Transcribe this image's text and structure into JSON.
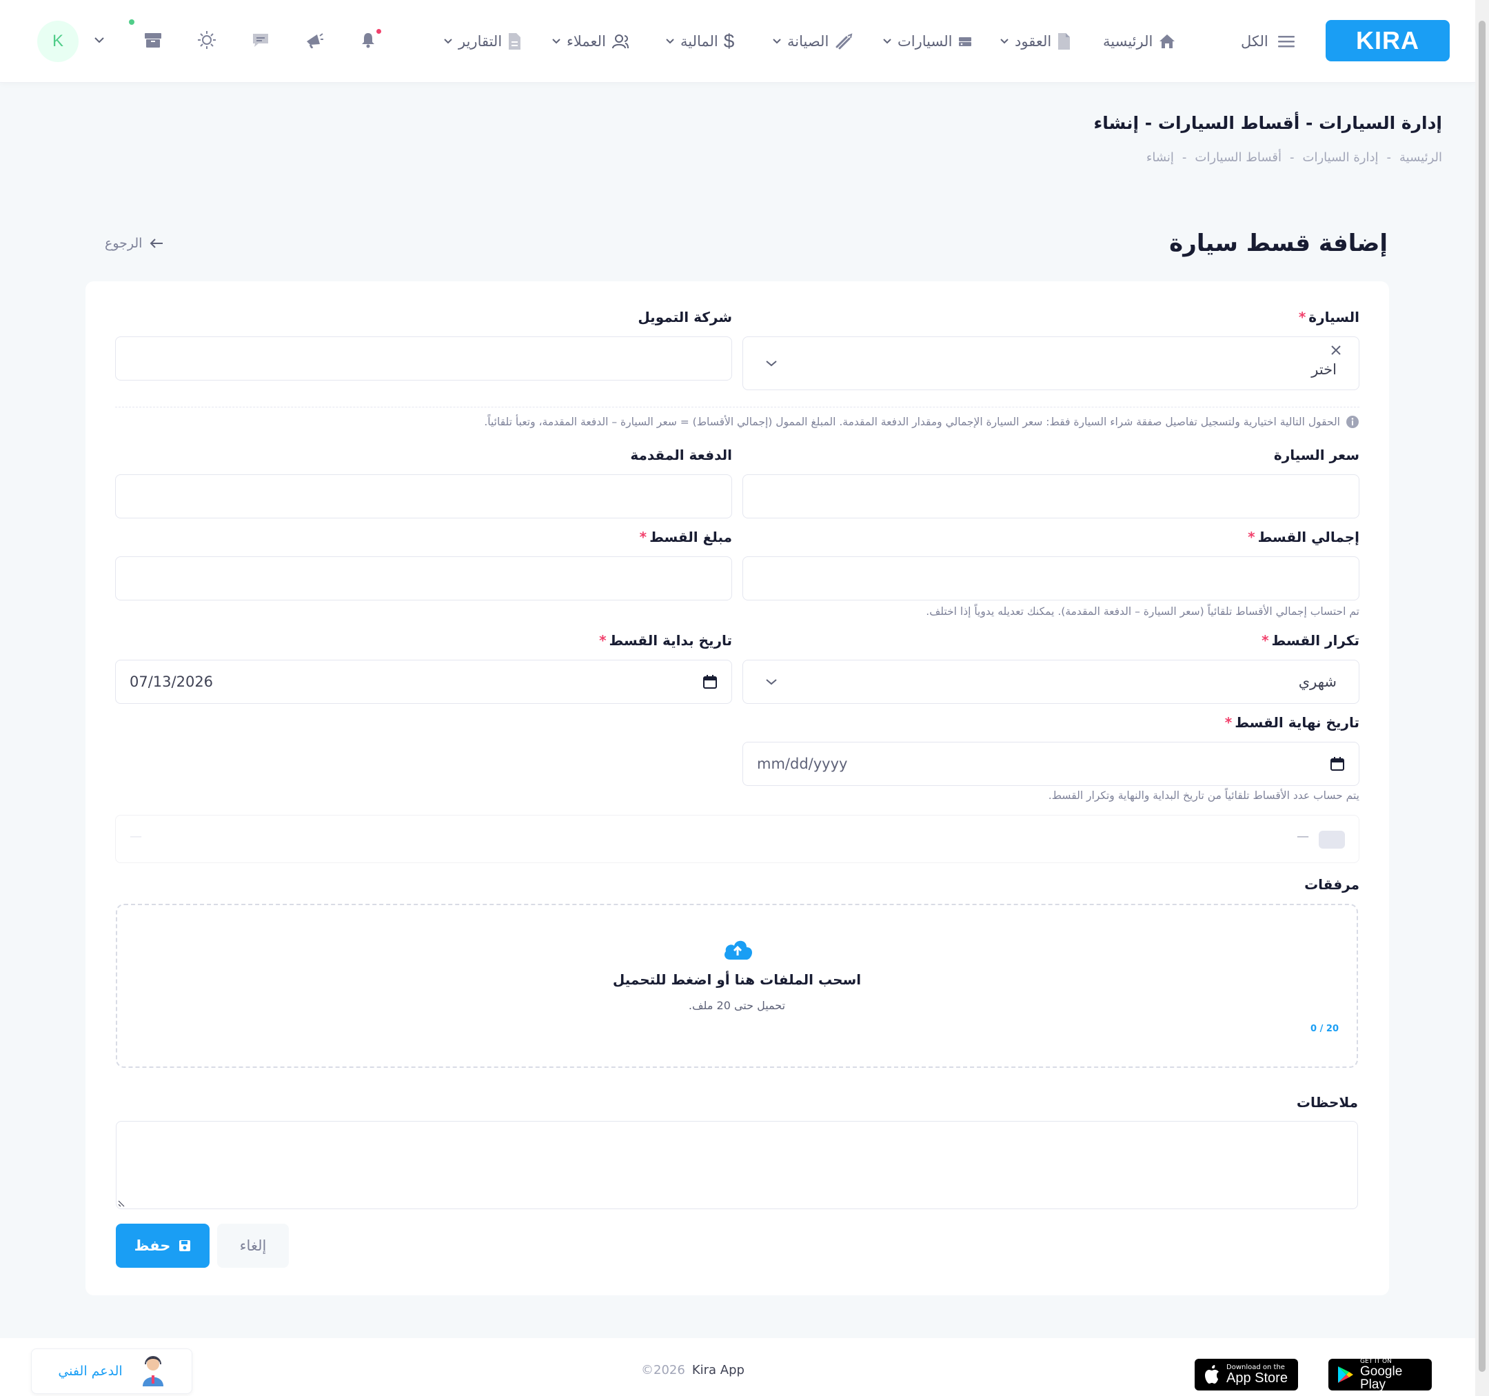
{
  "header": {
    "logo_text": "KIRA",
    "menu_all": "الكل",
    "nav": [
      {
        "label": "الرئيسية"
      },
      {
        "label": "العقود"
      },
      {
        "label": "السيارات"
      },
      {
        "label": "الصيانة"
      },
      {
        "label": "المالية"
      },
      {
        "label": "العملاء"
      },
      {
        "label": "التقارير"
      }
    ],
    "avatar_initial": "K"
  },
  "page": {
    "title": "إدارة السيارات - أقساط السيارات - إنشاء",
    "breadcrumb": [
      "الرئيسية",
      "إدارة السيارات",
      "أقساط السيارات",
      "إنشاء"
    ],
    "breadcrumb_sep": "-",
    "form_heading": "إضافة قسط سيارة",
    "back_label": "الرجوع"
  },
  "form": {
    "required_mark": "*",
    "car": {
      "label": "السيارة",
      "value": "اختر"
    },
    "finance_company": {
      "label": "شركة التمويل",
      "value": ""
    },
    "optional_note": "الحقول التالية اختيارية ولتسجيل تفاصيل صفقة شراء السيارة فقط: سعر السيارة الإجمالي ومقدار الدفعة المقدمة. المبلغ الممول (إجمالي الأقساط) = سعر السيارة – الدفعة المقدمة، وتعبأ تلقائياً.",
    "car_price": {
      "label": "سعر السيارة",
      "value": ""
    },
    "down_payment": {
      "label": "الدفعة المقدمة",
      "value": ""
    },
    "installment_total": {
      "label": "إجمالي القسط",
      "value": ""
    },
    "installment_amount": {
      "label": "مبلغ القسط",
      "value": ""
    },
    "total_hint": "تم احتساب إجمالي الأقساط تلقائياً (سعر السيارة – الدفعة المقدمة). يمكنك تعديله يدوياً إذا اختلف.",
    "frequency": {
      "label": "تكرار القسط",
      "value": "شهري"
    },
    "start_date": {
      "label": "تاريخ بداية القسط",
      "value": "07/13/2026"
    },
    "end_date": {
      "label": "تاريخ نهاية القسط",
      "placeholder": "mm/dd/yyyy"
    },
    "count_hint": "يتم حساب عدد الأقساط تلقائياً من تاريخ البداية والنهاية وتكرار القسط.",
    "count_summary": {
      "left": "—",
      "right": "—"
    },
    "attachments": {
      "label": "مرفقات",
      "title": "اسحب الملفات هنا أو اضغط للتحميل",
      "subtitle": "تحميل حتى 20 ملف.",
      "counter": "20 / 0"
    },
    "notes": {
      "label": "ملاحظات",
      "value": ""
    },
    "save_label": "حفظ",
    "cancel_label": "إلغاء"
  },
  "footer": {
    "copyright": "©2026",
    "app_name": "Kira App",
    "support_label": "الدعم الفني",
    "app_store_small": "Download on the",
    "app_store_big": "App Store",
    "play_small": "GET IT ON",
    "play_big": "Google Play"
  },
  "colors": {
    "primary": "#1a9ef4",
    "required": "#f1416c",
    "online": "#50cd89",
    "background": "#f5f8fa"
  },
  "icons": [
    "menu-icon",
    "home-icon",
    "document-icon",
    "car-icon",
    "wrench-icon",
    "dollar-icon",
    "users-icon",
    "report-icon",
    "bell-icon",
    "megaphone-icon",
    "chat-icon",
    "sun-icon",
    "gift-icon",
    "chevron-down-icon",
    "arrow-left-icon",
    "close-icon",
    "info-icon",
    "calendar-icon",
    "cloud-upload-icon",
    "save-icon",
    "resize-icon",
    "apple-icon",
    "google-play-icon",
    "support-agent-icon"
  ]
}
